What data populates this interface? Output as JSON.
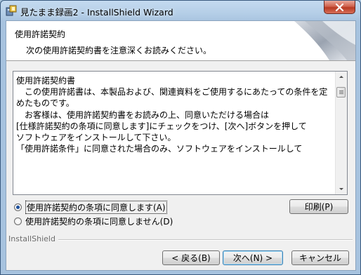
{
  "window": {
    "title": "見たまま録画2 - InstallShield Wizard"
  },
  "header": {
    "title": "使用許諾契約",
    "subtitle": "次の使用許諾契約書を注意深くお読みください。"
  },
  "license": {
    "lines": [
      "使用許諾契約書",
      "",
      "　この使用許諾書は、本製品および、関連資料をご使用するにあたっての条件を定",
      "めたものです。",
      "",
      "　お客様は、使用許諾契約書をお読みの上、同意いただける場合は",
      "[仕様許諾契約の条項に同意します]にチェックをつけ、[次へ]ボタンを押して",
      "ソフトウェアをインストールして下さい。",
      "",
      "「使用許諾条件」に同意された場合のみ、ソフトウェアをインストールして"
    ]
  },
  "options": {
    "accept_label": "使用許諾契約の条項に同意します(A)",
    "decline_label": "使用許諾契約の条項に同意しません(D)",
    "selected": "accept"
  },
  "buttons": {
    "print": "印刷(P)",
    "back": "< 戻る(B)",
    "next": "次へ(N) >",
    "cancel": "キャンセル"
  },
  "footer": {
    "brand": "InstallShield"
  },
  "icons": {
    "app": "installer-icon",
    "close": "close-icon"
  },
  "colors": {
    "window_frame": "#a7c3df",
    "close_button": "#c8452d",
    "default_button_border": "#3c7fb1"
  }
}
